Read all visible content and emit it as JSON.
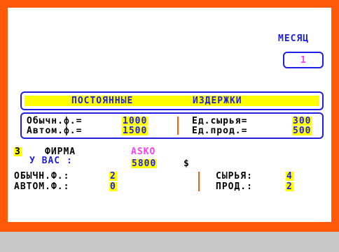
{
  "month": {
    "label": "МЕСЯЦ",
    "value": "1"
  },
  "fixed_costs": {
    "title_left": "ПОСТОЯННЫЕ",
    "title_right": "ИЗДЕРЖКИ",
    "regular_label": "Обычн.ф.=",
    "regular_value": "1000",
    "auto_label": "Автом.ф.=",
    "auto_value": "1500",
    "raw_unit_label": "Ед.сырья=",
    "raw_unit_value": "300",
    "product_unit_label": "Ед.прод.=",
    "product_unit_value": "500"
  },
  "firm": {
    "number": "3",
    "label": "ФИРМА",
    "name": "ASKO",
    "you_have_label": "У ВАС :",
    "money": "5800",
    "currency": "$",
    "regular_label": "ОБЫЧН.Ф.:",
    "regular_count": "2",
    "auto_label": "АВТОМ.Ф.:",
    "auto_count": "0",
    "raw_label": "СЫРЬЯ:",
    "raw_count": "4",
    "product_label": "ПРОД.:",
    "product_count": "2"
  },
  "colors": {
    "border": "#ff5a0a",
    "ink": "#1e1ee6",
    "highlight": "#ffff00",
    "accent": "#ff3cff",
    "divider": "#ff5a0a"
  }
}
